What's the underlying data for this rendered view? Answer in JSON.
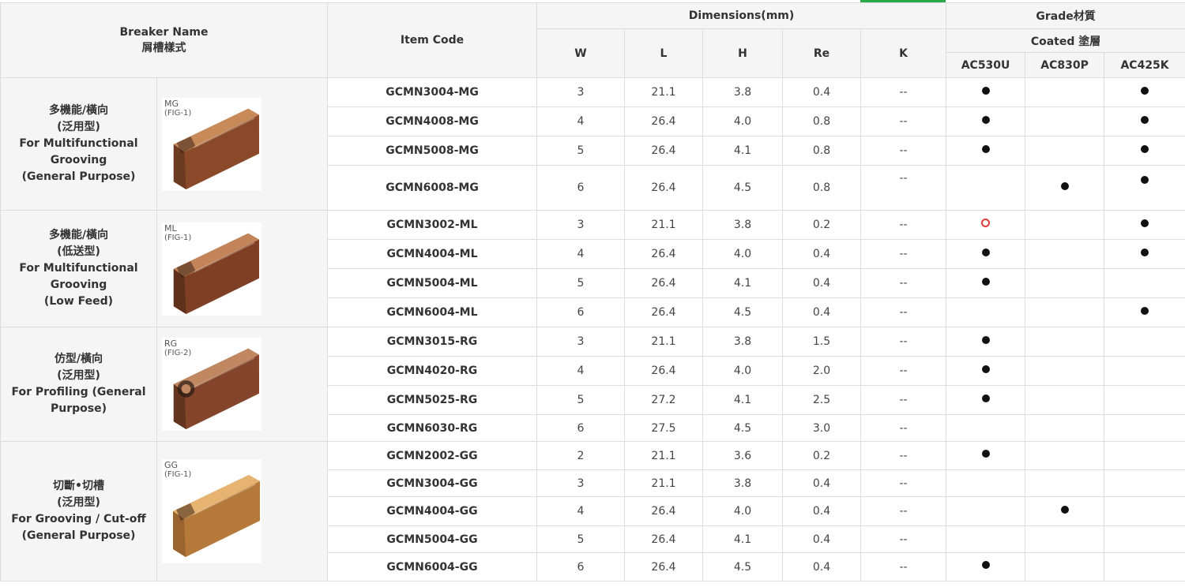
{
  "header": {
    "breaker_en": "Breaker Name",
    "breaker_zh": "屑槽樣式",
    "item_code": "Item Code",
    "dimensions": "Dimensions(mm)",
    "grade": "Grade材質",
    "coated": "Coated 塗層",
    "dims": [
      "W",
      "L",
      "H",
      "Re",
      "K"
    ],
    "grades": [
      "AC530U",
      "AC830P",
      "AC425K"
    ]
  },
  "colors": {
    "mark_filled": "#111111",
    "mark_open": "#e03a3a",
    "accent_bar": "#2aa84a",
    "header_bg": "#f5f5f5",
    "grid": "#dcdcdc"
  },
  "groups": [
    {
      "name_lines": [
        "多機能/橫向",
        "(泛用型)",
        "For Multifunctional",
        "Grooving",
        "(General Purpose)"
      ],
      "fig_label": "MG",
      "fig_sub": "(FIG-1)",
      "image_icon": "insert-mg-image",
      "rows": [
        {
          "code": "GCMN3004-MG",
          "W": "3",
          "L": "21.1",
          "H": "3.8",
          "Re": "0.4",
          "K": "--",
          "marks": [
            "filled",
            "",
            "filled"
          ]
        },
        {
          "code": "GCMN4008-MG",
          "W": "4",
          "L": "26.4",
          "H": "4.0",
          "Re": "0.8",
          "K": "--",
          "marks": [
            "filled",
            "",
            "filled"
          ]
        },
        {
          "code": "GCMN5008-MG",
          "W": "5",
          "L": "26.4",
          "H": "4.1",
          "Re": "0.8",
          "K": "--",
          "marks": [
            "filled",
            "",
            "filled"
          ]
        },
        {
          "code": "GCMN6008-MG",
          "W": "6",
          "L": "26.4",
          "H": "4.5",
          "Re": "0.8",
          "K": "--",
          "marks": [
            "",
            "filled",
            "filled"
          ]
        }
      ]
    },
    {
      "name_lines": [
        "多機能/橫向",
        "(低送型)",
        "For Multifunctional",
        "Grooving",
        "(Low Feed)"
      ],
      "fig_label": "ML",
      "fig_sub": "(FIG-1)",
      "image_icon": "insert-ml-image",
      "rows": [
        {
          "code": "GCMN3002-ML",
          "W": "3",
          "L": "21.1",
          "H": "3.8",
          "Re": "0.2",
          "K": "--",
          "marks": [
            "open",
            "",
            "filled"
          ]
        },
        {
          "code": "GCMN4004-ML",
          "W": "4",
          "L": "26.4",
          "H": "4.0",
          "Re": "0.4",
          "K": "--",
          "marks": [
            "filled",
            "",
            "filled"
          ]
        },
        {
          "code": "GCMN5004-ML",
          "W": "5",
          "L": "26.4",
          "H": "4.1",
          "Re": "0.4",
          "K": "--",
          "marks": [
            "filled",
            "",
            ""
          ]
        },
        {
          "code": "GCMN6004-ML",
          "W": "6",
          "L": "26.4",
          "H": "4.5",
          "Re": "0.4",
          "K": "--",
          "marks": [
            "",
            "",
            "filled"
          ]
        }
      ]
    },
    {
      "name_lines": [
        "仿型/橫向",
        "(泛用型)",
        "For Profiling (General",
        "Purpose)"
      ],
      "fig_label": "RG",
      "fig_sub": "(FIG-2)",
      "image_icon": "insert-rg-image",
      "rows": [
        {
          "code": "GCMN3015-RG",
          "W": "3",
          "L": "21.1",
          "H": "3.8",
          "Re": "1.5",
          "K": "--",
          "marks": [
            "filled",
            "",
            ""
          ]
        },
        {
          "code": "GCMN4020-RG",
          "W": "4",
          "L": "26.4",
          "H": "4.0",
          "Re": "2.0",
          "K": "--",
          "marks": [
            "filled",
            "",
            ""
          ]
        },
        {
          "code": "GCMN5025-RG",
          "W": "5",
          "L": "27.2",
          "H": "4.1",
          "Re": "2.5",
          "K": "--",
          "marks": [
            "filled",
            "",
            ""
          ]
        },
        {
          "code": "GCMN6030-RG",
          "W": "6",
          "L": "27.5",
          "H": "4.5",
          "Re": "3.0",
          "K": "--",
          "marks": [
            "",
            "",
            ""
          ]
        }
      ]
    },
    {
      "name_lines": [
        "切斷•切槽",
        "(泛用型)",
        "For Grooving / Cut-off",
        "(General Purpose)"
      ],
      "fig_label": "GG",
      "fig_sub": "(FIG-1)",
      "image_icon": "insert-gg-image",
      "rows": [
        {
          "code": "GCMN2002-GG",
          "W": "2",
          "L": "21.1",
          "H": "3.6",
          "Re": "0.2",
          "K": "--",
          "marks": [
            "filled",
            "",
            ""
          ]
        },
        {
          "code": "GCMN3004-GG",
          "W": "3",
          "L": "21.1",
          "H": "3.8",
          "Re": "0.4",
          "K": "--",
          "marks": [
            "",
            "",
            ""
          ]
        },
        {
          "code": "GCMN4004-GG",
          "W": "4",
          "L": "26.4",
          "H": "4.0",
          "Re": "0.4",
          "K": "--",
          "marks": [
            "",
            "filled",
            ""
          ]
        },
        {
          "code": "GCMN5004-GG",
          "W": "5",
          "L": "26.4",
          "H": "4.1",
          "Re": "0.4",
          "K": "--",
          "marks": [
            "",
            "",
            ""
          ]
        },
        {
          "code": "GCMN6004-GG",
          "W": "6",
          "L": "26.4",
          "H": "4.5",
          "Re": "0.4",
          "K": "--",
          "marks": [
            "filled",
            "",
            ""
          ]
        }
      ]
    }
  ]
}
